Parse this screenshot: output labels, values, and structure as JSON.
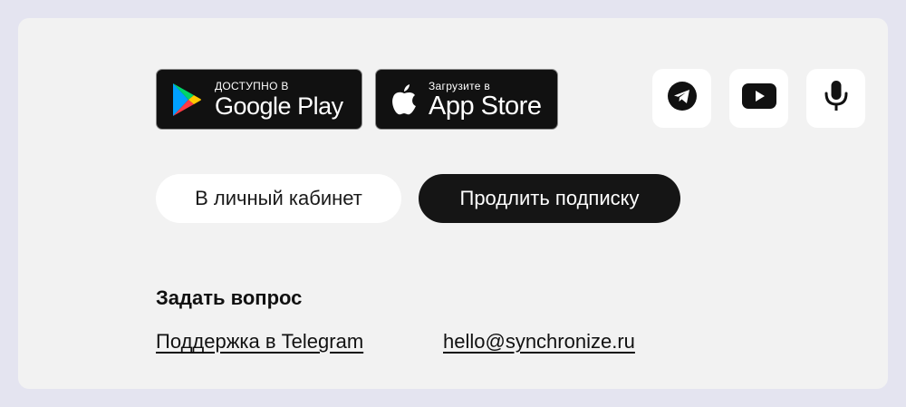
{
  "stores": {
    "google_play": {
      "small": "ДОСТУПНО В",
      "large": "Google Play"
    },
    "app_store": {
      "small": "Загрузите в",
      "large": "App Store"
    }
  },
  "social": [
    {
      "icon": "telegram-icon"
    },
    {
      "icon": "youtube-icon"
    },
    {
      "icon": "microphone-icon"
    }
  ],
  "actions": {
    "cabinet_label": "В личный кабинет",
    "renew_label": "Продлить подписку"
  },
  "contact": {
    "title": "Задать вопрос",
    "telegram_link": "Поддержка в Telegram",
    "email_link": "hello@synchronize.ru"
  },
  "colors": {
    "page_background": "#e4e4f0",
    "card_background": "#f2f2f2",
    "dark_button": "#151515"
  }
}
